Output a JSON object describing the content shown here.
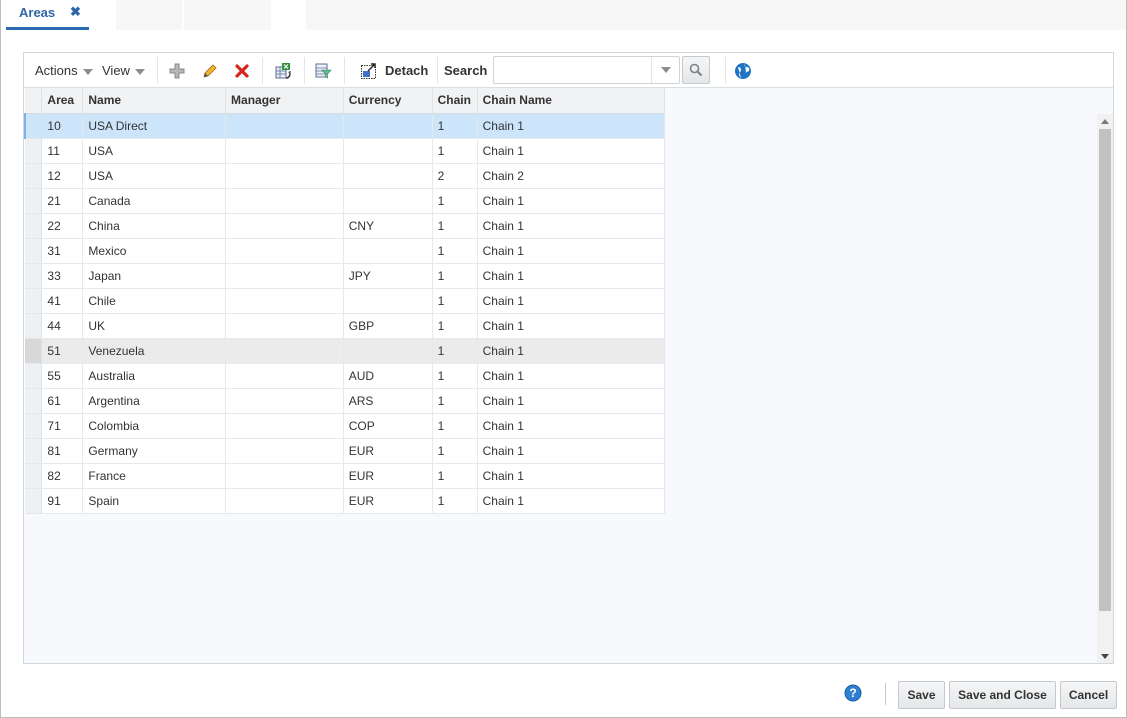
{
  "tabs": [
    {
      "label": "Areas",
      "active": true,
      "closable": true
    }
  ],
  "tab_close_glyph": "✖",
  "toolbar": {
    "actions_label": "Actions",
    "view_label": "View",
    "icons": [
      "add-icon",
      "edit-icon",
      "delete-icon",
      "export-excel-icon",
      "query-filter-icon",
      "detach-icon"
    ],
    "detach_label": "Detach",
    "search_label": "Search",
    "search_value": "",
    "search_placeholder": "",
    "globe_icon": "globe-icon"
  },
  "table": {
    "columns": [
      "Area",
      "Name",
      "Manager",
      "Currency",
      "Chain",
      "Chain Name"
    ],
    "rows": [
      {
        "area": "10",
        "name": "USA Direct",
        "manager": "",
        "currency": "",
        "chain": "1",
        "chain_name": "Chain 1",
        "state": "selected"
      },
      {
        "area": "11",
        "name": "USA",
        "manager": "",
        "currency": "",
        "chain": "1",
        "chain_name": "Chain 1"
      },
      {
        "area": "12",
        "name": "USA",
        "manager": "",
        "currency": "",
        "chain": "2",
        "chain_name": "Chain 2"
      },
      {
        "area": "21",
        "name": "Canada",
        "manager": "",
        "currency": "",
        "chain": "1",
        "chain_name": "Chain 1"
      },
      {
        "area": "22",
        "name": "China",
        "manager": "",
        "currency": "CNY",
        "chain": "1",
        "chain_name": "Chain 1"
      },
      {
        "area": "31",
        "name": "Mexico",
        "manager": "",
        "currency": "",
        "chain": "1",
        "chain_name": "Chain 1"
      },
      {
        "area": "33",
        "name": "Japan",
        "manager": "",
        "currency": "JPY",
        "chain": "1",
        "chain_name": "Chain 1"
      },
      {
        "area": "41",
        "name": "Chile",
        "manager": "",
        "currency": "",
        "chain": "1",
        "chain_name": "Chain 1"
      },
      {
        "area": "44",
        "name": "UK",
        "manager": "",
        "currency": "GBP",
        "chain": "1",
        "chain_name": "Chain 1"
      },
      {
        "area": "51",
        "name": "Venezuela",
        "manager": "",
        "currency": "",
        "chain": "1",
        "chain_name": "Chain 1",
        "state": "hover"
      },
      {
        "area": "55",
        "name": "Australia",
        "manager": "",
        "currency": "AUD",
        "chain": "1",
        "chain_name": "Chain 1"
      },
      {
        "area": "61",
        "name": "Argentina",
        "manager": "",
        "currency": "ARS",
        "chain": "1",
        "chain_name": "Chain 1"
      },
      {
        "area": "71",
        "name": "Colombia",
        "manager": "",
        "currency": "COP",
        "chain": "1",
        "chain_name": "Chain 1"
      },
      {
        "area": "81",
        "name": "Germany",
        "manager": "",
        "currency": "EUR",
        "chain": "1",
        "chain_name": "Chain 1"
      },
      {
        "area": "82",
        "name": "France",
        "manager": "",
        "currency": "EUR",
        "chain": "1",
        "chain_name": "Chain 1"
      },
      {
        "area": "91",
        "name": "Spain",
        "manager": "",
        "currency": "EUR",
        "chain": "1",
        "chain_name": "Chain 1"
      }
    ]
  },
  "footer": {
    "help_icon": "help-icon",
    "save_label": "Save",
    "save_close_label": "Save and Close",
    "cancel_label": "Cancel"
  },
  "colors": {
    "accent": "#2a6ab0",
    "selected_row": "#cde5fa",
    "hover_row": "#ebebeb",
    "delete_red": "#d7261e",
    "globe_blue": "#1f74c6"
  }
}
